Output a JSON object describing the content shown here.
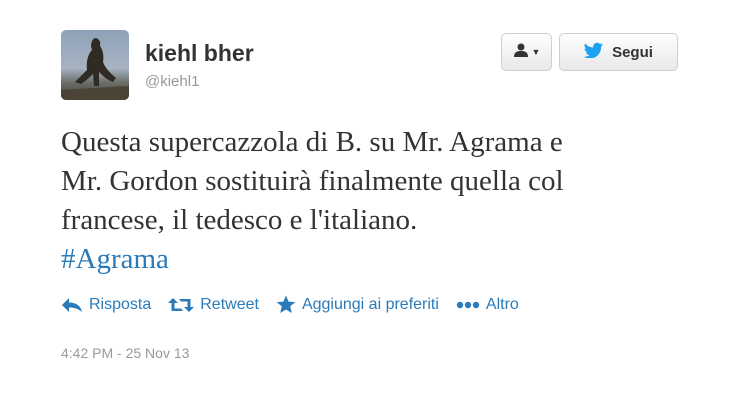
{
  "user": {
    "name": "kiehl bher",
    "screen_name": "@kiehl1"
  },
  "buttons": {
    "follow_label": "Segui"
  },
  "tweet": {
    "lines": [
      "Questa supercazzola di B. su Mr. Agrama e",
      "Mr. Gordon sostituirà finalmente quella col",
      "francese, il tedesco e l'italiano."
    ],
    "hashtag": "#Agrama"
  },
  "actions": {
    "reply": "Risposta",
    "retweet": "Retweet",
    "favorite": "Aggiungi ai preferiti",
    "more": "Altro"
  },
  "timestamp": "4:42 PM - 25 Nov 13",
  "colors": {
    "link": "#2b7bb9",
    "text": "#333333",
    "muted": "#999999",
    "twitter_blue": "#1da1f2"
  },
  "icons": {
    "user_menu": "user-icon",
    "follow": "twitter-bird-icon",
    "reply": "reply-icon",
    "retweet": "retweet-icon",
    "favorite": "star-icon",
    "more": "ellipsis-icon"
  }
}
